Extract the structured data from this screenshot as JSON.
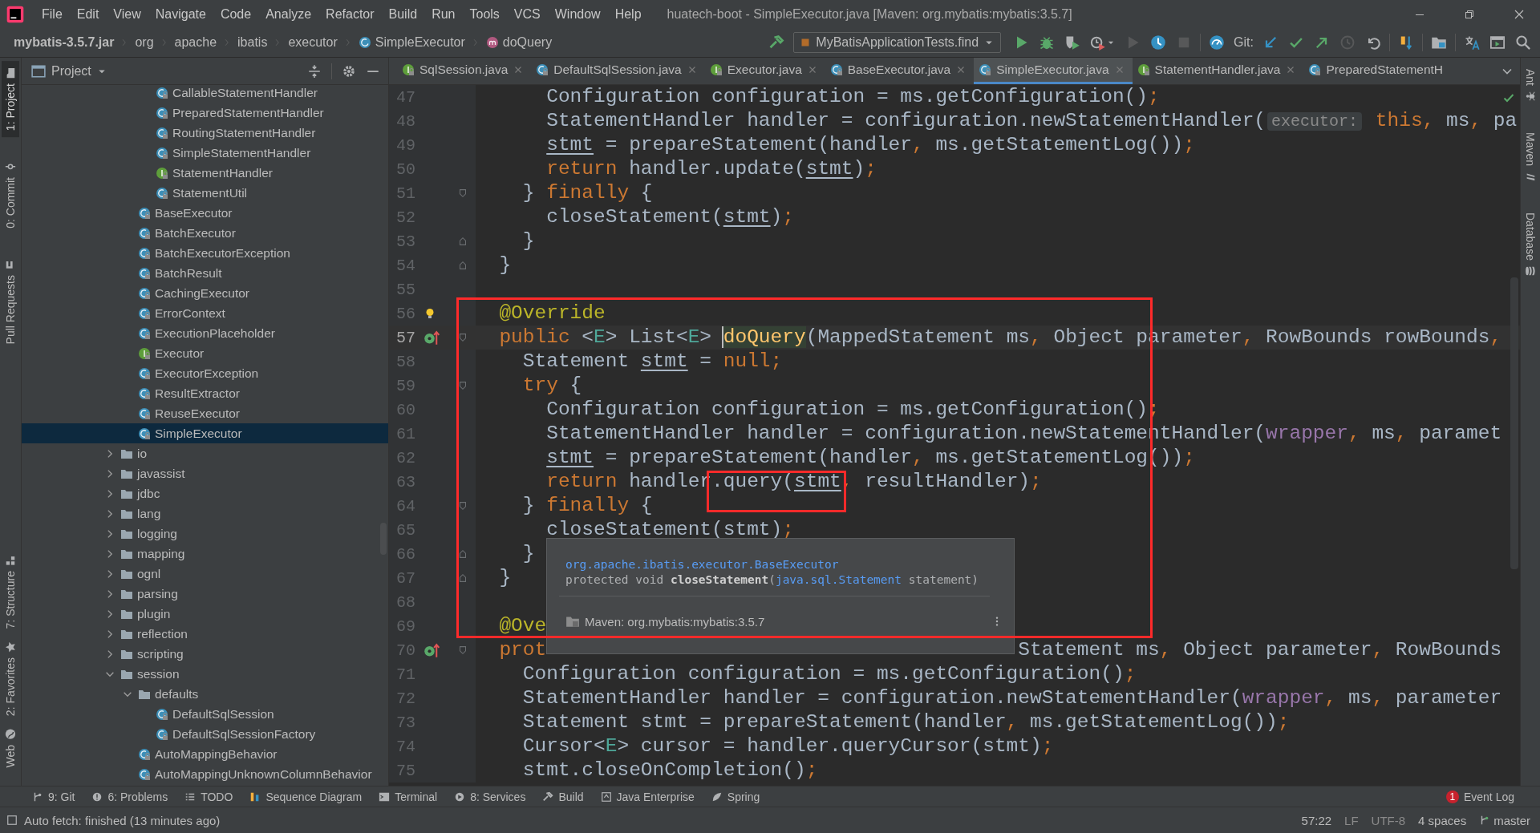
{
  "menu": [
    "File",
    "Edit",
    "View",
    "Navigate",
    "Code",
    "Analyze",
    "Refactor",
    "Build",
    "Run",
    "Tools",
    "VCS",
    "Window",
    "Help"
  ],
  "window": {
    "title": "huatech-boot - SimpleExecutor.java [Maven: org.mybatis:mybatis:3.5.7]"
  },
  "breadcrumb": [
    {
      "label": "mybatis-3.5.7.jar",
      "kind": "jar"
    },
    {
      "label": "org",
      "kind": "package"
    },
    {
      "label": "apache",
      "kind": "package"
    },
    {
      "label": "ibatis",
      "kind": "package"
    },
    {
      "label": "executor",
      "kind": "package"
    },
    {
      "label": "SimpleExecutor",
      "kind": "class"
    },
    {
      "label": "doQuery",
      "kind": "method"
    }
  ],
  "toolbar": [
    {
      "kind": "build",
      "disabled": false
    },
    {
      "kind": "run_config",
      "text": "MyBatisApplicationTests.find"
    },
    {
      "kind": "run",
      "disabled": false
    },
    {
      "kind": "debug",
      "disabled": false
    },
    {
      "kind": "coverage",
      "disabled": false
    },
    {
      "kind": "profile",
      "disabled": false
    },
    {
      "kind": "resume",
      "disabled": true
    },
    {
      "kind": "timer",
      "disabled": false
    },
    {
      "kind": "stop",
      "disabled": true
    },
    {
      "kind": "gauge",
      "disabled": false
    },
    {
      "kind": "label",
      "text": "Git:"
    },
    {
      "kind": "update",
      "disabled": false
    },
    {
      "kind": "commit",
      "disabled": false
    },
    {
      "kind": "push",
      "disabled": false
    },
    {
      "kind": "history",
      "disabled": true
    },
    {
      "kind": "rollback",
      "disabled": false
    },
    {
      "kind": "bars",
      "disabled": false
    },
    {
      "kind": "structure",
      "disabled": false
    },
    {
      "kind": "translate",
      "disabled": false
    },
    {
      "kind": "window",
      "disabled": false
    },
    {
      "kind": "search",
      "disabled": false
    }
  ],
  "left_stripe": [
    {
      "label": "1: Project",
      "kind": "project",
      "selected": true
    },
    {
      "label": "0: Commit",
      "kind": "commit",
      "selected": false
    },
    {
      "label": "Pull Requests",
      "kind": "pull",
      "selected": false
    },
    {
      "label": "7: Structure",
      "kind": "structure",
      "selected": false
    },
    {
      "label": "2: Favorites",
      "kind": "favorites",
      "selected": false
    },
    {
      "label": "Web",
      "kind": "web",
      "selected": false
    }
  ],
  "right_stripe": [
    {
      "label": "Ant",
      "kind": "ant"
    },
    {
      "label": "Maven",
      "kind": "maven"
    },
    {
      "label": "Database",
      "kind": "database"
    }
  ],
  "project": {
    "title": "Project",
    "tree": [
      {
        "children": [
          {
            "children": [
              {
                "label": "CallableStatementHandler",
                "kind": "class",
                "selected": false
              },
              {
                "label": "PreparedStatementHandler",
                "kind": "class",
                "selected": false
              },
              {
                "label": "RoutingStatementHandler",
                "kind": "class",
                "selected": false
              },
              {
                "label": "SimpleStatementHandler",
                "kind": "class",
                "selected": false
              },
              {
                "label": "StatementHandler",
                "kind": "interface",
                "selected": false
              },
              {
                "label": "StatementUtil",
                "kind": "class",
                "selected": false
              }
            ]
          },
          {
            "label": "BaseExecutor",
            "kind": "class",
            "selected": false
          },
          {
            "label": "BatchExecutor",
            "kind": "class",
            "selected": false
          },
          {
            "label": "BatchExecutorException",
            "kind": "class",
            "selected": false
          },
          {
            "label": "BatchResult",
            "kind": "class",
            "selected": false
          },
          {
            "label": "CachingExecutor",
            "kind": "class",
            "selected": false
          },
          {
            "label": "ErrorContext",
            "kind": "class",
            "selected": false
          },
          {
            "label": "ExecutionPlaceholder",
            "kind": "class",
            "selected": false
          },
          {
            "label": "Executor",
            "kind": "interface",
            "selected": false
          },
          {
            "label": "ExecutorException",
            "kind": "class",
            "selected": false
          },
          {
            "label": "ResultExtractor",
            "kind": "class",
            "selected": false
          },
          {
            "label": "ReuseExecutor",
            "kind": "class",
            "selected": false
          },
          {
            "label": "SimpleExecutor",
            "kind": "class",
            "selected": true
          }
        ]
      },
      {
        "label": "io",
        "kind": "folder",
        "expanded": false,
        "selected": false
      },
      {
        "label": "javassist",
        "kind": "folder",
        "expanded": false,
        "selected": false
      },
      {
        "label": "jdbc",
        "kind": "folder",
        "expanded": false,
        "selected": false
      },
      {
        "label": "lang",
        "kind": "folder",
        "expanded": false,
        "selected": false
      },
      {
        "label": "logging",
        "kind": "folder",
        "expanded": false,
        "selected": false
      },
      {
        "label": "mapping",
        "kind": "folder",
        "expanded": false,
        "selected": false
      },
      {
        "label": "ognl",
        "kind": "folder",
        "expanded": false,
        "selected": false
      },
      {
        "label": "parsing",
        "kind": "folder",
        "expanded": false,
        "selected": false
      },
      {
        "label": "plugin",
        "kind": "folder",
        "expanded": false,
        "selected": false
      },
      {
        "label": "reflection",
        "kind": "folder",
        "expanded": false,
        "selected": false
      },
      {
        "label": "scripting",
        "kind": "folder",
        "expanded": false,
        "selected": false
      },
      {
        "label": "session",
        "kind": "folder",
        "expanded": true,
        "selected": false,
        "children": [
          {
            "label": "defaults",
            "kind": "folder",
            "expanded": true,
            "selected": false,
            "children": [
              {
                "label": "DefaultSqlSession",
                "kind": "class",
                "selected": false
              },
              {
                "label": "DefaultSqlSessionFactory",
                "kind": "class",
                "selected": false
              }
            ]
          },
          {
            "label": "AutoMappingBehavior",
            "kind": "class",
            "selected": false
          },
          {
            "label": "AutoMappingUnknownColumnBehavior",
            "kind": "class",
            "selected": false
          }
        ]
      }
    ]
  },
  "tabs": [
    {
      "label": "SqlSession.java",
      "kind": "interface",
      "selected": false
    },
    {
      "label": "DefaultSqlSession.java",
      "kind": "class",
      "selected": false
    },
    {
      "label": "Executor.java",
      "kind": "interface",
      "selected": false
    },
    {
      "label": "BaseExecutor.java",
      "kind": "class",
      "selected": false
    },
    {
      "label": "SimpleExecutor.java",
      "kind": "class",
      "selected": true
    },
    {
      "label": "StatementHandler.java",
      "kind": "interface",
      "selected": false
    },
    {
      "label": "PreparedStatementH",
      "kind": "class",
      "selected": false
    }
  ],
  "editor": {
    "lines": [
      {
        "number": "47",
        "current": false,
        "framed": false,
        "tokens": [
          {
            "kind": "plain",
            "text": "      Configuration configuration = ms.getConfiguration();"
          }
        ]
      },
      {
        "number": "48",
        "current": false,
        "framed": false,
        "tokens": [
          {
            "kind": "plain",
            "text": "      StatementHandler handler = configuration.newStatementHandler("
          },
          {
            "kind": "hint",
            "text": "executor:"
          },
          {
            "kind": "keyword",
            "text": " this"
          },
          {
            "kind": "plain",
            "text": ", ms, pa"
          }
        ]
      },
      {
        "number": "49",
        "current": false,
        "framed": false,
        "tokens": [
          {
            "kind": "reassigned",
            "text": "      stmt"
          },
          {
            "kind": "plain",
            "text": " = prepareStatement(handler, ms.getStatementLog());"
          }
        ]
      },
      {
        "number": "50",
        "current": false,
        "framed": false,
        "tokens": [
          {
            "kind": "keyword",
            "text": "      return"
          },
          {
            "kind": "plain",
            "text": " handler.update("
          },
          {
            "kind": "reassigned",
            "text": "stmt"
          },
          {
            "kind": "plain",
            "text": ");"
          }
        ]
      },
      {
        "number": "51",
        "current": false,
        "framed": false,
        "gutter": [
          {
            "kind": "fold_start"
          }
        ],
        "tokens": [
          {
            "kind": "plain",
            "text": "    } "
          },
          {
            "kind": "keyword",
            "text": "finally"
          },
          {
            "kind": "plain",
            "text": " {"
          }
        ]
      },
      {
        "number": "52",
        "current": false,
        "framed": false,
        "tokens": [
          {
            "kind": "plain",
            "text": "      closeStatement("
          },
          {
            "kind": "reassigned",
            "text": "stmt"
          },
          {
            "kind": "plain",
            "text": ");"
          }
        ]
      },
      {
        "number": "53",
        "current": false,
        "framed": false,
        "gutter": [
          {
            "kind": "fold_end"
          }
        ],
        "tokens": [
          {
            "kind": "plain",
            "text": "    }"
          }
        ]
      },
      {
        "number": "54",
        "current": false,
        "framed": false,
        "gutter": [
          {
            "kind": "fold_end"
          }
        ],
        "tokens": [
          {
            "kind": "plain",
            "text": "  }"
          }
        ]
      },
      {
        "number": "55",
        "current": false,
        "framed": false
      },
      {
        "number": "56",
        "current": false,
        "framed": true,
        "gutter": [
          {
            "kind": "bulb"
          }
        ],
        "tokens": [
          {
            "kind": "annotation",
            "text": "  @Override"
          }
        ]
      },
      {
        "number": "57",
        "current": true,
        "framed": true,
        "gutter": [
          {
            "kind": "override"
          },
          {
            "kind": "fold_start"
          }
        ],
        "tokens": [
          {
            "kind": "keyword",
            "text": "  public"
          },
          {
            "kind": "plain",
            "text": " <"
          },
          {
            "kind": "type_param",
            "text": "E"
          },
          {
            "kind": "plain",
            "text": "> List<"
          },
          {
            "kind": "type_param",
            "text": "E"
          },
          {
            "kind": "plain",
            "text": "> "
          },
          {
            "kind": "caret_declaration",
            "text": "doQuery"
          },
          {
            "kind": "plain",
            "text": "(MappedStatement ms, Object parameter, RowBounds rowBounds,"
          }
        ]
      },
      {
        "number": "58",
        "current": false,
        "framed": true,
        "tokens": [
          {
            "kind": "plain",
            "text": "    Statement "
          },
          {
            "kind": "reassigned",
            "text": "stmt"
          },
          {
            "kind": "plain",
            "text": " = "
          },
          {
            "kind": "keyword",
            "text": "null;"
          }
        ]
      },
      {
        "number": "59",
        "current": false,
        "framed": true,
        "gutter": [
          {
            "kind": "fold_start"
          }
        ],
        "tokens": [
          {
            "kind": "keyword",
            "text": "    try"
          },
          {
            "kind": "plain",
            "text": " {"
          }
        ]
      },
      {
        "number": "60",
        "current": false,
        "framed": true,
        "tokens": [
          {
            "kind": "plain",
            "text": "      Configuration configuration = ms.getConfiguration();"
          }
        ]
      },
      {
        "number": "61",
        "current": false,
        "framed": true,
        "tokens": [
          {
            "kind": "plain",
            "text": "      StatementHandler handler = configuration.newStatementHandler("
          },
          {
            "kind": "field",
            "text": "wrapper"
          },
          {
            "kind": "plain",
            "text": ", ms, paramet"
          }
        ]
      },
      {
        "number": "62",
        "current": false,
        "framed": true,
        "tokens": [
          {
            "kind": "reassigned",
            "text": "      stmt"
          },
          {
            "kind": "plain",
            "text": " = prepareStatement(handler, ms.getStatementLog());"
          }
        ]
      },
      {
        "number": "63",
        "current": false,
        "framed": true,
        "tokens": [
          {
            "kind": "keyword",
            "text": "      return",
            "framed": false
          },
          {
            "kind": "plain",
            "text": " handler",
            "framed": false
          },
          {
            "kind": "plain",
            "text": ".query(",
            "framed": true
          },
          {
            "kind": "reassigned",
            "text": "stmt",
            "framed": true
          },
          {
            "kind": "plain",
            "text": ", resultHandler);",
            "framed": false
          }
        ]
      },
      {
        "number": "64",
        "current": false,
        "framed": true,
        "gutter": [
          {
            "kind": "fold_start"
          }
        ],
        "tokens": [
          {
            "kind": "plain",
            "text": "    } "
          },
          {
            "kind": "keyword",
            "text": "finally"
          },
          {
            "kind": "plain",
            "text": " {"
          }
        ]
      },
      {
        "number": "65",
        "current": false,
        "framed": true,
        "tokens": [
          {
            "kind": "plain",
            "text": "      closeStatement("
          },
          {
            "kind": "reassigned",
            "text": "stmt"
          },
          {
            "kind": "plain",
            "text": ");"
          }
        ]
      },
      {
        "number": "66",
        "current": false,
        "framed": true,
        "gutter": [
          {
            "kind": "fold_end"
          }
        ],
        "tokens": [
          {
            "kind": "plain",
            "text": "    }"
          }
        ]
      },
      {
        "number": "67",
        "current": false,
        "framed": true,
        "gutter": [
          {
            "kind": "fold_end"
          }
        ],
        "tokens": [
          {
            "kind": "plain",
            "text": "  }"
          }
        ]
      },
      {
        "number": "68",
        "current": false,
        "framed": true
      },
      {
        "number": "69",
        "current": false,
        "framed": true,
        "tokens": [
          {
            "kind": "annotation",
            "text": "  @Ove"
          }
        ]
      },
      {
        "number": "70",
        "current": false,
        "framed": false,
        "gutter": [
          {
            "kind": "override"
          },
          {
            "kind": "fold_start"
          }
        ],
        "tokens": [
          {
            "kind": "keyword",
            "text": "  prot"
          },
          {
            "kind": "plain",
            "text": "                                        Statement ms, Object parameter, RowBounds"
          }
        ]
      },
      {
        "number": "71",
        "current": false,
        "framed": false,
        "tokens": [
          {
            "kind": "plain",
            "text": "    Configuration configuration = ms.getConfiguration();"
          }
        ]
      },
      {
        "number": "72",
        "current": false,
        "framed": false,
        "tokens": [
          {
            "kind": "plain",
            "text": "    StatementHandler handler = configuration.newStatementHandler("
          },
          {
            "kind": "field",
            "text": "wrapper"
          },
          {
            "kind": "plain",
            "text": ", ms, parameter"
          }
        ]
      },
      {
        "number": "73",
        "current": false,
        "framed": false,
        "tokens": [
          {
            "kind": "plain",
            "text": "    Statement stmt = prepareStatement(handler, ms.getStatementLog());"
          }
        ]
      },
      {
        "number": "74",
        "current": false,
        "framed": false,
        "tokens": [
          {
            "kind": "plain",
            "text": "    Cursor<"
          },
          {
            "kind": "type_param",
            "text": "E"
          },
          {
            "kind": "plain",
            "text": "> cursor = handler.queryCursor(stmt);"
          }
        ]
      },
      {
        "number": "75",
        "current": false,
        "framed": false,
        "tokens": [
          {
            "kind": "plain",
            "text": "    stmt.closeOnCompletion();"
          }
        ]
      }
    ]
  },
  "popup": {
    "owner": "org.apache.ibatis.executor.BaseExecutor",
    "signature": [
      {
        "kind": "plain",
        "text": "protected void "
      },
      {
        "kind": "bold",
        "text": "closeStatement"
      },
      {
        "kind": "plain",
        "text": "("
      },
      {
        "kind": "link",
        "text": "java.sql.Statement"
      },
      {
        "kind": "plain",
        "text": " statement)"
      }
    ],
    "source": "Maven: org.mybatis:mybatis:3.5.7"
  },
  "tool_windows": [
    {
      "label": "9: Git",
      "kind": "git"
    },
    {
      "label": "6: Problems",
      "kind": "problems"
    },
    {
      "label": "TODO",
      "kind": "todo"
    },
    {
      "label": "Sequence Diagram",
      "kind": "sequence"
    },
    {
      "label": "Terminal",
      "kind": "terminal"
    },
    {
      "label": "8: Services",
      "kind": "services"
    },
    {
      "label": "Build",
      "kind": "build"
    },
    {
      "label": "Java Enterprise",
      "kind": "enterprise"
    },
    {
      "label": "Spring",
      "kind": "spring"
    }
  ],
  "event_log": {
    "label": "Event Log",
    "count": "1"
  },
  "status": {
    "message": "Auto fetch: finished (13 minutes ago)",
    "position": "57:22",
    "line_separator": "LF",
    "encoding": "UTF-8",
    "indent": "4 spaces",
    "branch": "master"
  }
}
